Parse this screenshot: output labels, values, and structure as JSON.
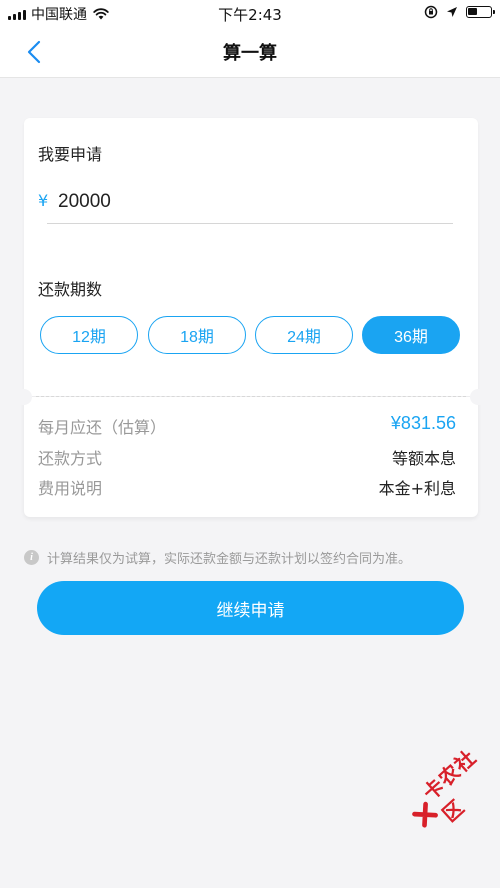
{
  "status_bar": {
    "carrier": "中国联通",
    "time": "下午2:43"
  },
  "nav": {
    "title": "算一算"
  },
  "form": {
    "apply_label": "我要申请",
    "currency_symbol": "¥",
    "amount_value": "20000",
    "term_label": "还款期数",
    "terms": [
      {
        "label": "12期",
        "selected": false
      },
      {
        "label": "18期",
        "selected": false
      },
      {
        "label": "24期",
        "selected": false
      },
      {
        "label": "36期",
        "selected": true
      }
    ]
  },
  "summary": {
    "rows": [
      {
        "label": "每月应还（估算）",
        "value": "¥831.56"
      },
      {
        "label": "还款方式",
        "value": "等额本息"
      },
      {
        "label": "费用说明",
        "value": "本金+利息"
      }
    ]
  },
  "notice": {
    "icon": "info-icon",
    "text": "计算结果仅为试算，实际还款金额与还款计划以签约合同为准。"
  },
  "actions": {
    "continue_label": "继续申请"
  },
  "watermark": {
    "text": "卡农社区"
  },
  "colors": {
    "accent": "#13a7f5",
    "background": "#f4f4f6",
    "watermark": "#d8202a"
  }
}
